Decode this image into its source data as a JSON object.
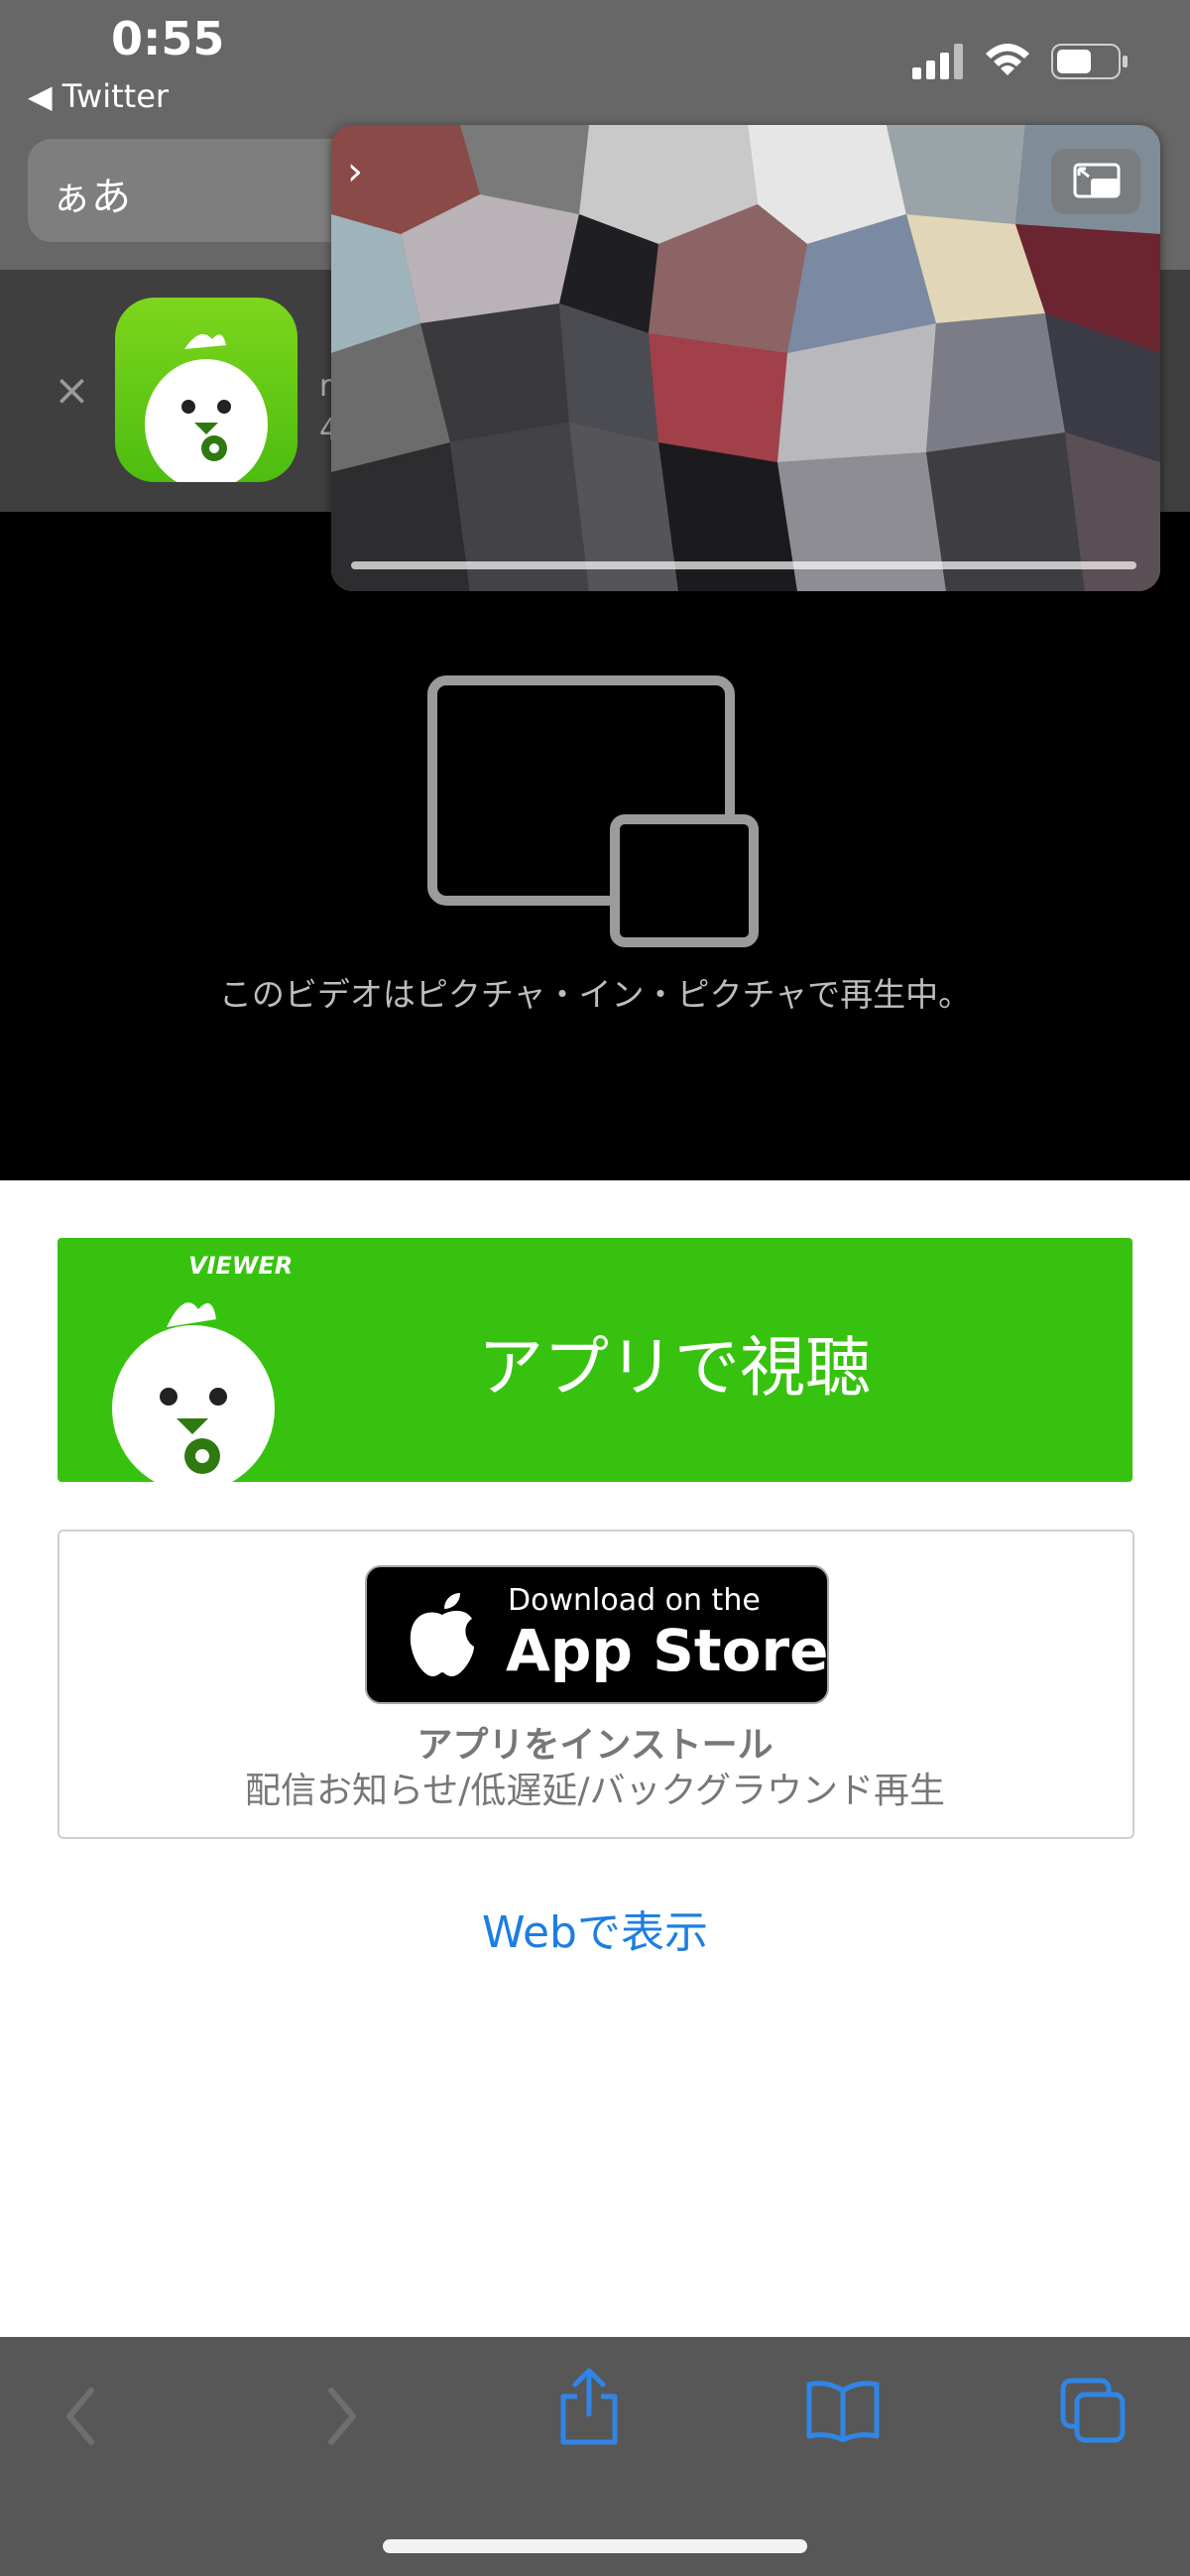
{
  "status_bar": {
    "time": "0:55",
    "back_app": "◀ Twitter",
    "icons": [
      "signal-icon",
      "wifi-icon",
      "battery-icon"
    ]
  },
  "address_bar": {
    "text_size_label": "ぁあ"
  },
  "app_banner": {
    "close_label": "×",
    "partial_text": "r\n4"
  },
  "video": {
    "pip_message": "このビデオはピクチャ・イン・ピクチャで再生中。"
  },
  "pip_window": {
    "collapse_label": "›"
  },
  "main": {
    "viewer_tag": "VIEWER",
    "watch_in_app": "アプリで視聴",
    "appstore_small": "Download on the",
    "appstore_big": "App Store",
    "install_title": "アプリをインストール",
    "install_subtitle": "配信お知らせ/低遅延/バックグラウンド再生",
    "web_link": "Webで表示"
  },
  "toolbar": {
    "items": [
      "back-icon",
      "forward-icon",
      "share-icon",
      "bookmarks-icon",
      "tabs-icon"
    ]
  },
  "colors": {
    "brand_green": "#37c20f",
    "link_blue": "#1d7ee0",
    "toolbar_icon_blue": "#2f86e6"
  }
}
